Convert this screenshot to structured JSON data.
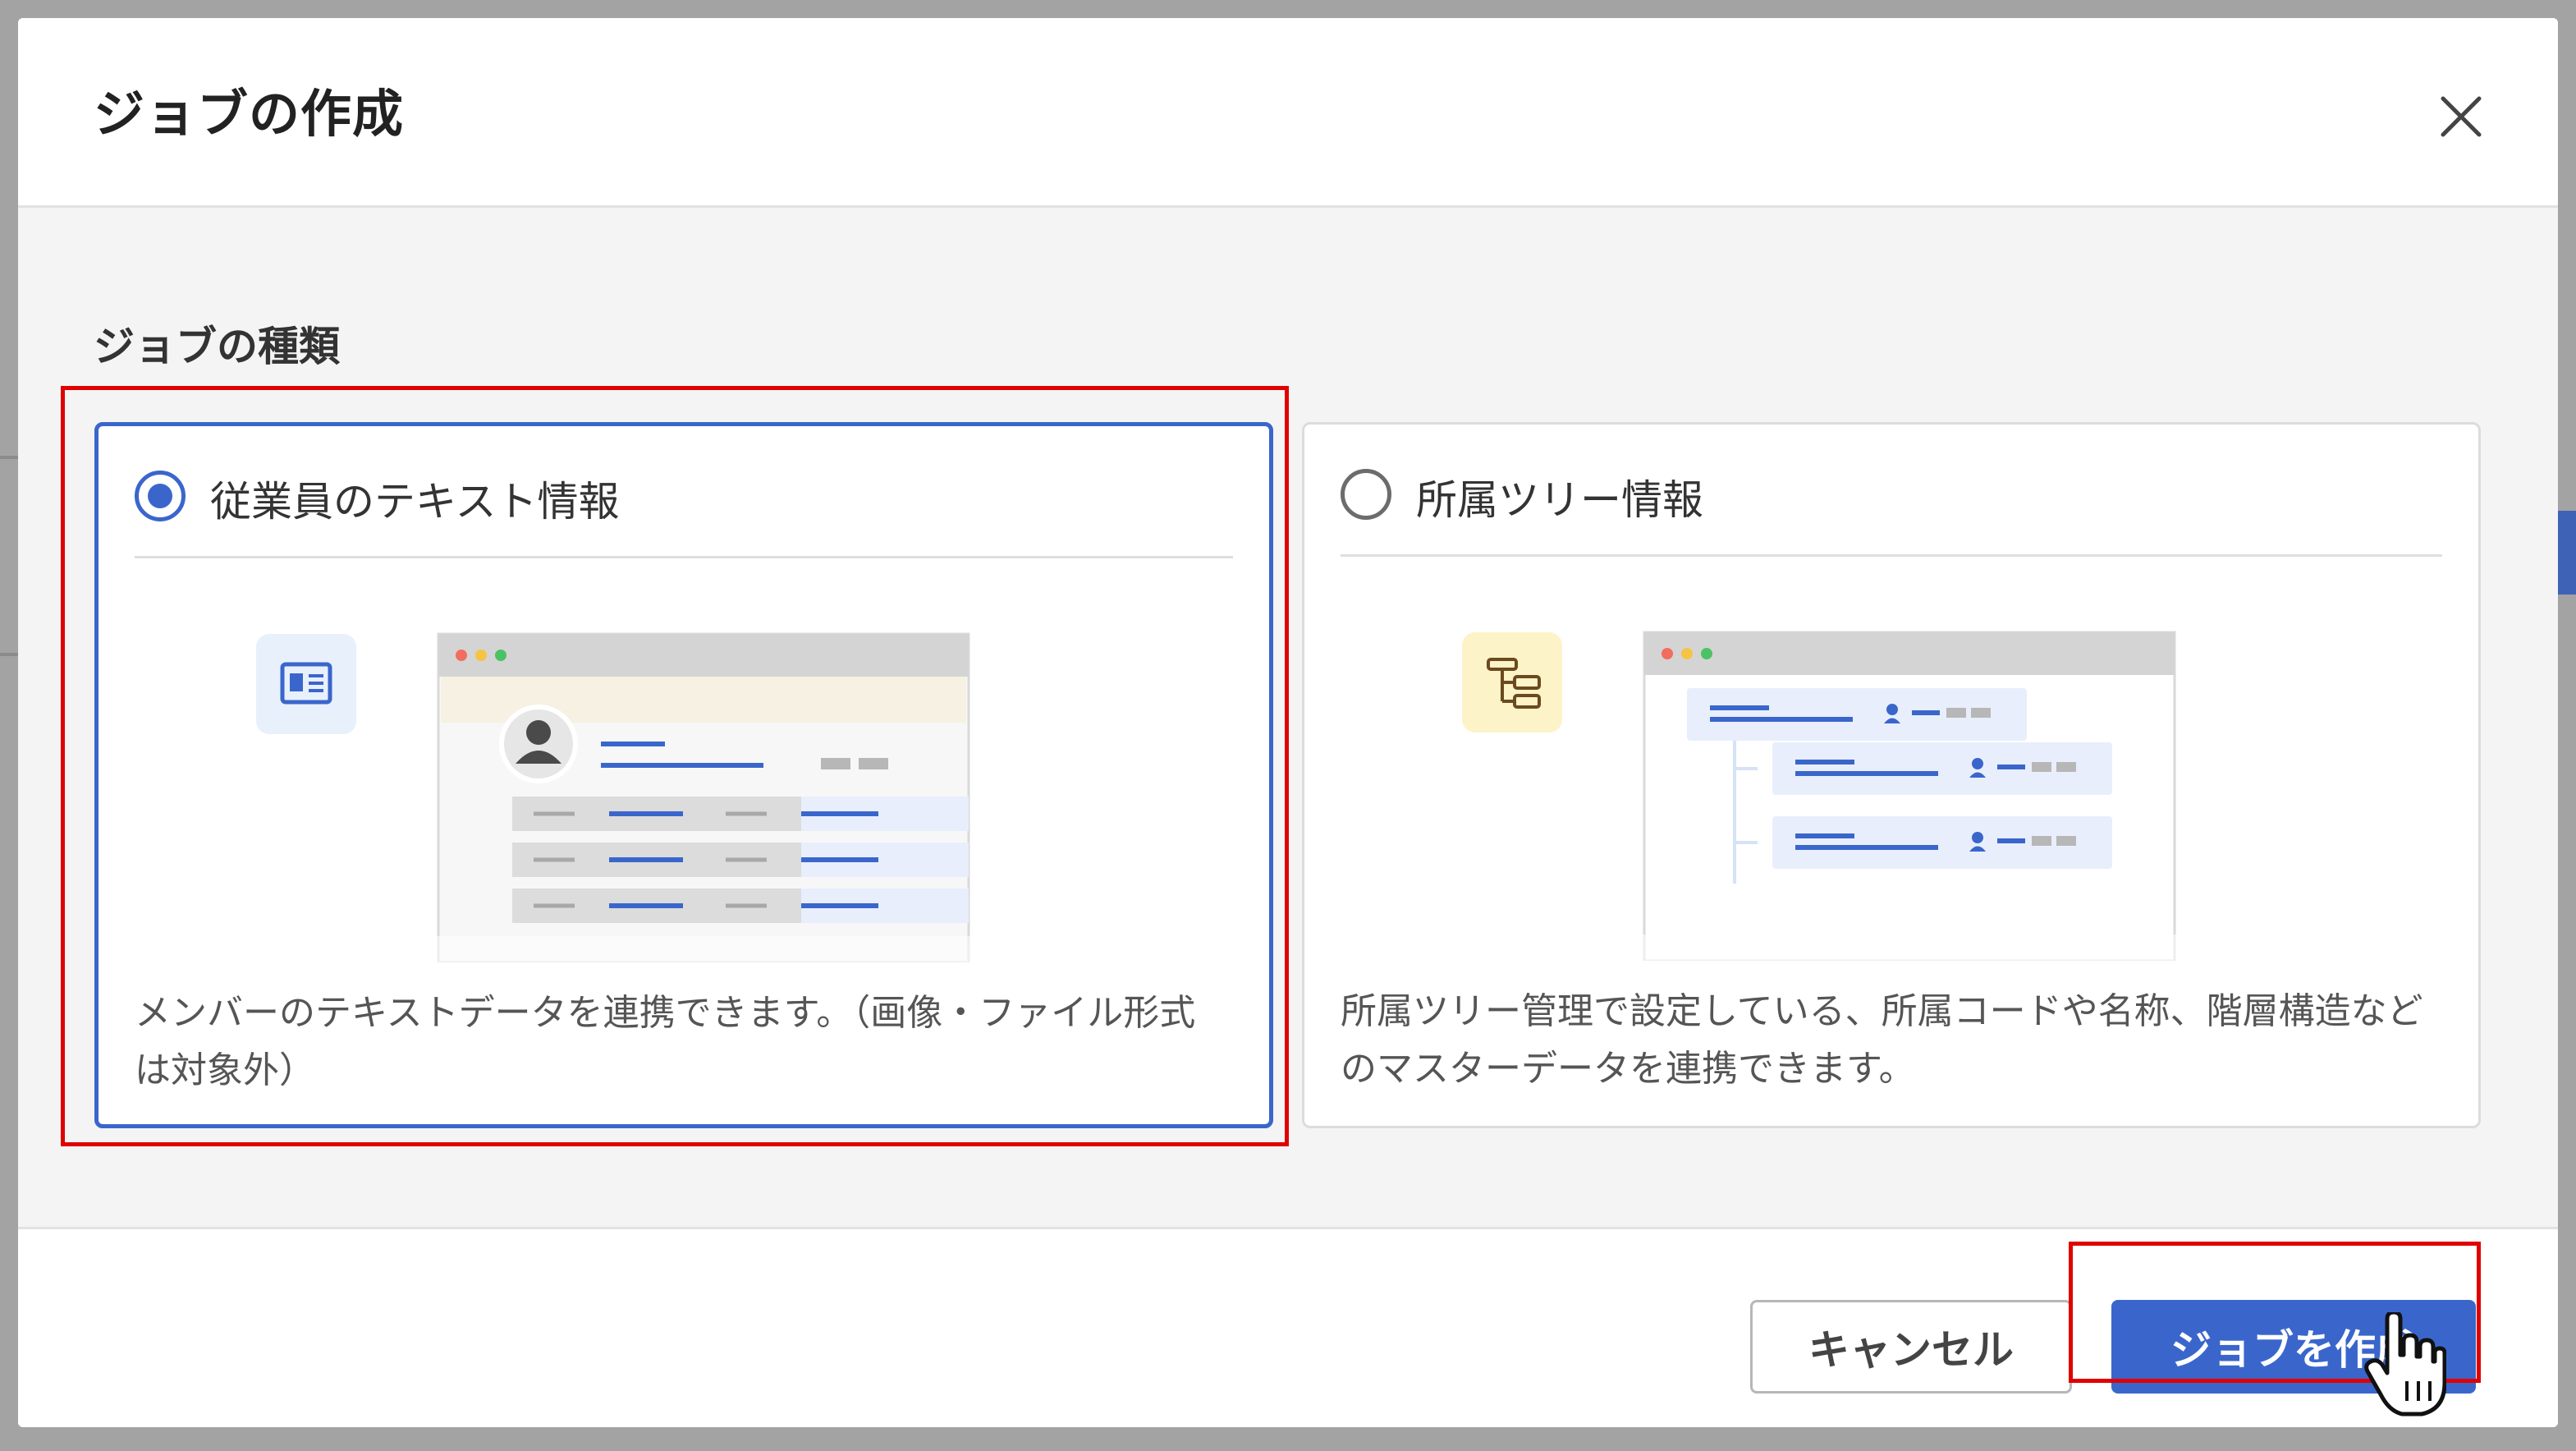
{
  "dialog": {
    "title": "ジョブの作成",
    "close_icon": "close-icon"
  },
  "section": {
    "label": "ジョブの種類"
  },
  "options": [
    {
      "title": "従業員のテキスト情報",
      "selected": true,
      "description": "メンバーのテキストデータを連携できます。（画像・ファイル形式は対象外）",
      "icon": "id-card-icon"
    },
    {
      "title": "所属ツリー情報",
      "selected": false,
      "description": "所属ツリー管理で設定している、所属コードや名称、階層構造などのマスターデータを連携できます。",
      "icon": "tree-structure-icon"
    }
  ],
  "footer": {
    "cancel_label": "キャンセル",
    "create_label": "ジョブを作成"
  },
  "colors": {
    "accent": "#3a66cc",
    "highlight": "#e00000"
  }
}
